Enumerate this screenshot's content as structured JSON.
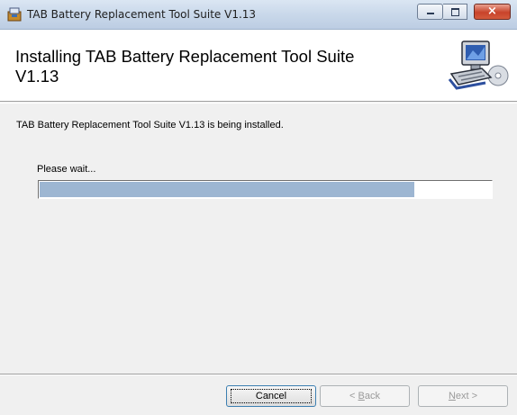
{
  "window": {
    "title": "TAB Battery Replacement Tool Suite V1.13",
    "close_glyph": "×"
  },
  "header": {
    "title": "Installing TAB Battery Replacement Tool Suite V1.13",
    "graphic_icon": "computer-with-cd-icon"
  },
  "body": {
    "status_text": "TAB Battery Replacement Tool Suite V1.13 is being installed.",
    "wait_text": "Please wait...",
    "progress_fraction": 0.83
  },
  "buttons": {
    "cancel_label": "Cancel",
    "back_prefix": "< ",
    "back_access_key": "B",
    "back_rest": "ack",
    "next_access_key": "N",
    "next_rest": "ext >"
  },
  "colors": {
    "progress_fill": "#9db6d2",
    "close_button": "#c8432b"
  }
}
